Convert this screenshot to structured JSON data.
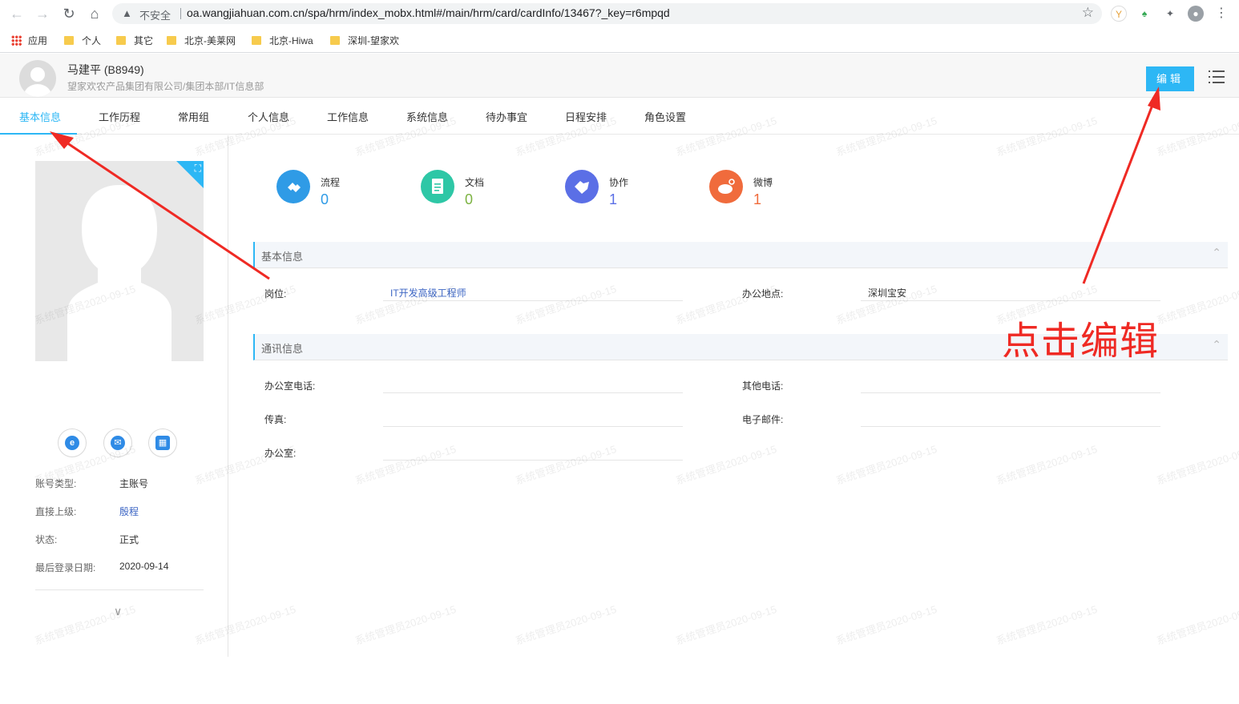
{
  "browser": {
    "insecure_label": "不安全",
    "url": "oa.wangjiahuan.com.cn/spa/hrm/index_mobx.html#/main/hrm/card/cardInfo/13467?_key=r6mpqd",
    "bookmarks": [
      "应用",
      "个人",
      "其它",
      "北京-美莱网",
      "北京-Hiwa",
      "深圳-望家欢"
    ]
  },
  "header": {
    "user_name": "马建平 (B8949)",
    "department": "望家欢农产品集团有限公司/集团本部/IT信息部",
    "edit_label": "编辑"
  },
  "tabs": [
    "基本信息",
    "工作历程",
    "常用组",
    "个人信息",
    "工作信息",
    "系统信息",
    "待办事宜",
    "日程安排",
    "角色设置"
  ],
  "stats": [
    {
      "label": "流程",
      "count": "0",
      "color": "#2f9be6"
    },
    {
      "label": "文档",
      "count": "0",
      "color": "#2ec7a6"
    },
    {
      "label": "协作",
      "count": "1",
      "color": "#5b6fe6"
    },
    {
      "label": "微博",
      "count": "1",
      "color": "#f06b3c"
    }
  ],
  "profile": {
    "rows": [
      {
        "label": "账号类型:",
        "value": "主账号"
      },
      {
        "label": "直接上级:",
        "value": "殷程"
      },
      {
        "label": "状态:",
        "value": "正式"
      },
      {
        "label": "最后登录日期:",
        "value": "2020-09-14"
      }
    ]
  },
  "sections": {
    "basic": {
      "title": "基本信息",
      "position_label": "岗位:",
      "position_value": "IT开发高级工程师",
      "office_location_label": "办公地点:",
      "office_location_value": "深圳宝安"
    },
    "contact": {
      "title": "通讯信息",
      "office_phone_label": "办公室电话:",
      "other_phone_label": "其他电话:",
      "fax_label": "传真:",
      "email_label": "电子邮件:",
      "office_label": "办公室:"
    }
  },
  "watermark": "系统管理员2020-09-15",
  "annotation": "点击编辑"
}
